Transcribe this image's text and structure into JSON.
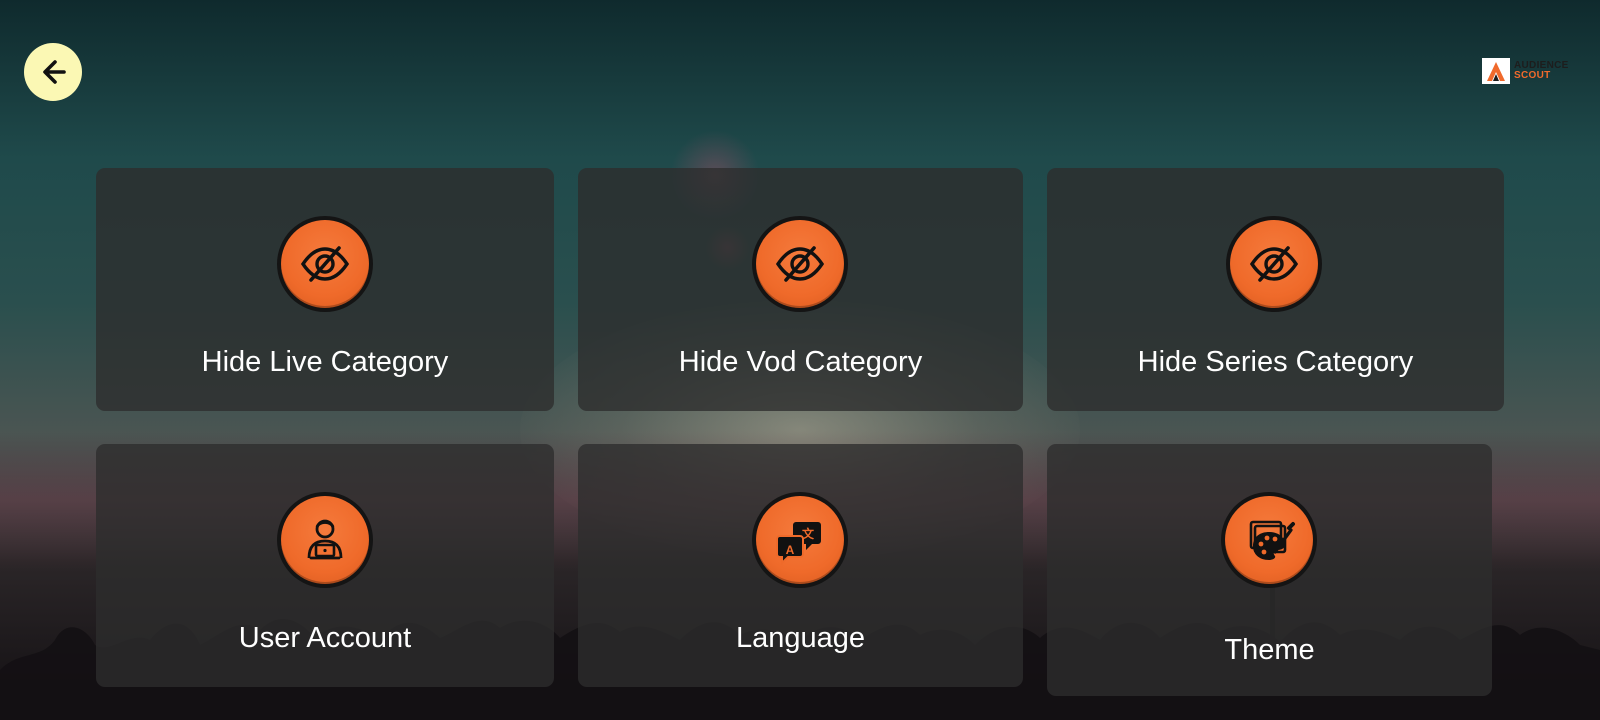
{
  "header": {
    "back_icon": "arrow-left-icon",
    "logo": {
      "line1": "AUDIENCE",
      "line2": "SCOUT",
      "brand_color": "#f06a2c"
    }
  },
  "cards": [
    {
      "label": "Hide Live Category",
      "icon": "eye-off-icon"
    },
    {
      "label": "Hide Vod Category",
      "icon": "eye-off-icon"
    },
    {
      "label": "Hide Series Category",
      "icon": "eye-off-icon"
    },
    {
      "label": "User Account",
      "icon": "user-laptop-icon"
    },
    {
      "label": "Language",
      "icon": "translate-icon"
    },
    {
      "label": "Theme",
      "icon": "palette-icon"
    }
  ],
  "colors": {
    "accent": "#ef6a2a",
    "back_button": "#fbf8b4",
    "card_bg": "rgba(45,45,45,0.78)",
    "text": "#ffffff"
  }
}
